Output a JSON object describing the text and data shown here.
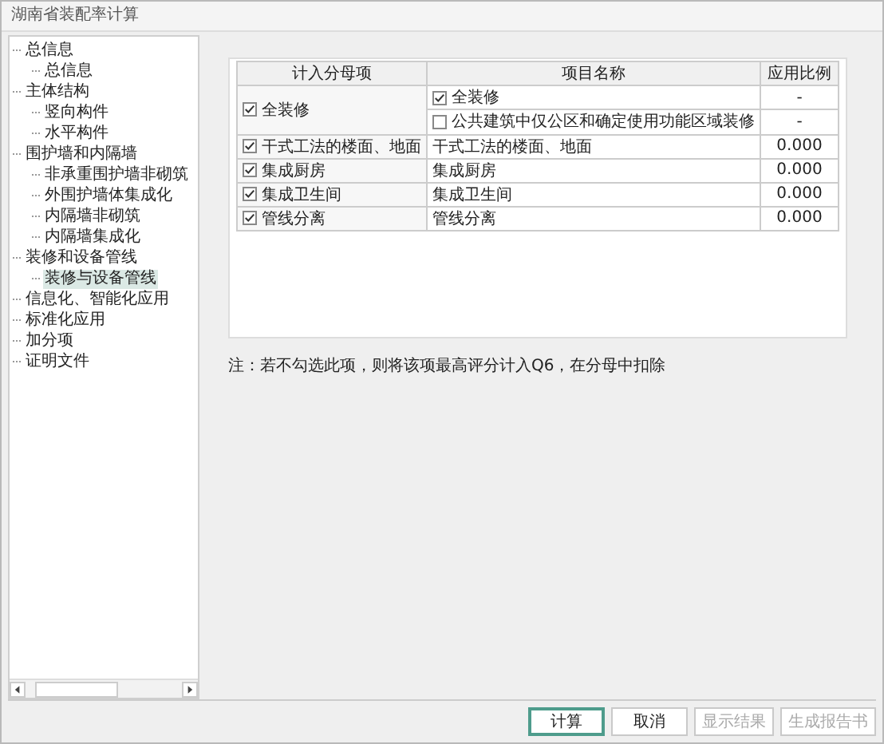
{
  "window": {
    "title": "湖南省装配率计算"
  },
  "tree": [
    {
      "label": "总信息",
      "selected": false,
      "children": [
        {
          "label": "总信息",
          "selected": false
        }
      ]
    },
    {
      "label": "主体结构",
      "selected": false,
      "children": [
        {
          "label": "竖向构件",
          "selected": false
        },
        {
          "label": "水平构件",
          "selected": false
        }
      ]
    },
    {
      "label": "围护墙和内隔墙",
      "selected": false,
      "children": [
        {
          "label": "非承重围护墙非砌筑",
          "selected": false
        },
        {
          "label": "外围护墙体集成化",
          "selected": false
        },
        {
          "label": "内隔墙非砌筑",
          "selected": false
        },
        {
          "label": "内隔墙集成化",
          "selected": false
        }
      ]
    },
    {
      "label": "装修和设备管线",
      "selected": false,
      "children": [
        {
          "label": "装修与设备管线",
          "selected": true
        }
      ]
    },
    {
      "label": "信息化、智能化应用",
      "selected": false
    },
    {
      "label": "标准化应用",
      "selected": false
    },
    {
      "label": "加分项",
      "selected": false
    },
    {
      "label": "证明文件",
      "selected": false
    }
  ],
  "table": {
    "columns": [
      "计入分母项",
      "项目名称",
      "应用比例"
    ],
    "groups": [
      {
        "label": "全装修",
        "checked": true,
        "items": [
          {
            "kind": "checkbox",
            "name": "全装修",
            "checked": true,
            "ratio": "-"
          },
          {
            "kind": "checkbox",
            "name": "公共建筑中仅公区和确定使用功能区域装修",
            "checked": false,
            "ratio": "-"
          }
        ]
      },
      {
        "label": "干式工法的楼面、地面",
        "checked": true,
        "items": [
          {
            "kind": "text",
            "name": "干式工法的楼面、地面",
            "ratio": "0.000"
          }
        ]
      },
      {
        "label": "集成厨房",
        "checked": true,
        "items": [
          {
            "kind": "text",
            "name": "集成厨房",
            "ratio": "0.000"
          }
        ]
      },
      {
        "label": "集成卫生间",
        "checked": true,
        "items": [
          {
            "kind": "text",
            "name": "集成卫生间",
            "ratio": "0.000"
          }
        ]
      },
      {
        "label": "管线分离",
        "checked": true,
        "items": [
          {
            "kind": "text",
            "name": "管线分离",
            "ratio": "0.000"
          }
        ]
      }
    ]
  },
  "note": "注：若不勾选此项，则将该项最高评分计入Q6，在分母中扣除",
  "buttons": [
    {
      "label": "计算",
      "disabled": false,
      "default": true
    },
    {
      "label": "取消",
      "disabled": false,
      "default": false
    },
    {
      "label": "显示结果",
      "disabled": true,
      "default": false
    },
    {
      "label": "生成报告书",
      "disabled": true,
      "default": false
    }
  ]
}
